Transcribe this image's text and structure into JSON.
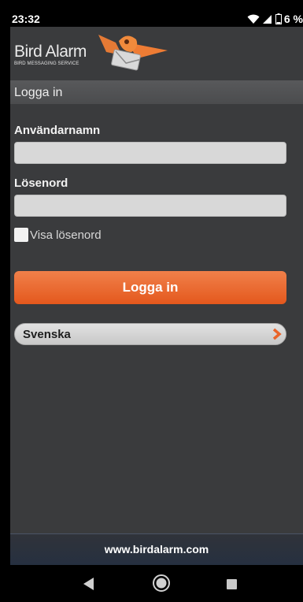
{
  "status_bar": {
    "time": "23:32",
    "battery": "6 %"
  },
  "header": {
    "logo_text": "Bird Alarm",
    "logo_subtitle": "BIRD MESSAGING SERVICE"
  },
  "section": {
    "title": "Logga in"
  },
  "form": {
    "username_label": "Användarnamn",
    "username_value": "",
    "password_label": "Lösenord",
    "password_value": "",
    "show_password_label": "Visa lösenord",
    "show_password_checked": false,
    "login_button": "Logga in"
  },
  "language": {
    "selected": "Svenska"
  },
  "footer": {
    "website": "www.birdalarm.com"
  },
  "colors": {
    "accent": "#e9642a",
    "background": "#3a3b3d",
    "footer": "#2b313b"
  },
  "icons": {
    "wifi": "wifi-icon",
    "signal": "signal-icon",
    "battery": "battery-icon",
    "logo": "bird-envelope-logo",
    "chevron": "chevron-right-icon",
    "back": "back-triangle-icon",
    "home": "home-circle-icon",
    "recent": "recent-square-icon"
  }
}
